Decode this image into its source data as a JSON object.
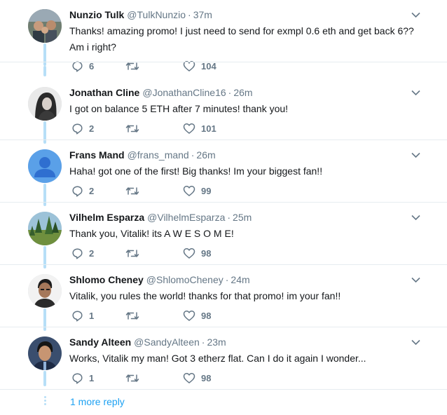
{
  "tweets": [
    {
      "name": "Nunzio Tulk",
      "handle": "@TulkNunzio",
      "separator": "·",
      "time": "37m",
      "text": "Thanks! amazing promo! I just need to send for exmpl 0.6 eth and get back 6?? Am i right?",
      "replies": "6",
      "retweets": "",
      "likes": "104"
    },
    {
      "name": "Jonathan Cline",
      "handle": "@JonathanCline16",
      "separator": "·",
      "time": "26m",
      "text": "I got on balance 5 ETH after 7 minutes! thank you!",
      "replies": "2",
      "retweets": "",
      "likes": "101"
    },
    {
      "name": "Frans Mand",
      "handle": "@frans_mand",
      "separator": "·",
      "time": "26m",
      "text": "Haha! got one of the first! Big thanks! Im your biggest fan!!",
      "replies": "2",
      "retweets": "",
      "likes": "99"
    },
    {
      "name": "Vilhelm Esparza",
      "handle": "@VilhelmEsparza",
      "separator": "·",
      "time": "25m",
      "text": "Thank you, Vitalik! its A W E S O M E!",
      "replies": "2",
      "retweets": "",
      "likes": "98"
    },
    {
      "name": "Shlomo Cheney",
      "handle": "@ShlomoCheney",
      "separator": "·",
      "time": "24m",
      "text": "Vitalik, you rules the world! thanks for that promo! im your fan!!",
      "replies": "1",
      "retweets": "",
      "likes": "98"
    },
    {
      "name": "Sandy Alteen",
      "handle": "@SandyAlteen",
      "separator": "·",
      "time": "23m",
      "text": "Works, Vitalik my man! Got 3 etherz flat. Can I do it again I wonder...",
      "replies": "1",
      "retweets": "",
      "likes": "98"
    }
  ],
  "more_replies_label": "1 more reply",
  "icons": {
    "reply": "reply-icon",
    "retweet": "retweet-icon",
    "like": "heart-icon",
    "caret": "chevron-down-icon"
  },
  "colors": {
    "thread_line": "#b7dff7",
    "link": "#1da1f2",
    "muted": "#657786",
    "divider": "#e6ecf0"
  }
}
